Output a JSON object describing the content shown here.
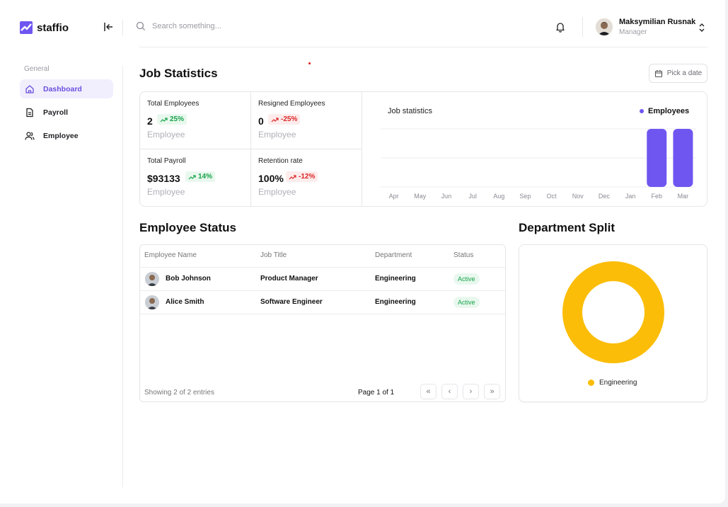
{
  "app": {
    "name": "staffio"
  },
  "search": {
    "placeholder": "Search something..."
  },
  "user": {
    "name": "Maksymilian Rusnak",
    "role": "Manager"
  },
  "sidebar": {
    "section": "General",
    "items": [
      {
        "label": "Dashboard",
        "icon": "home-icon",
        "active": true
      },
      {
        "label": "Payroll",
        "icon": "document-icon",
        "active": false
      },
      {
        "label": "Employee",
        "icon": "users-icon",
        "active": false
      }
    ]
  },
  "job_statistics": {
    "title": "Job Statistics",
    "date_button": "Pick a date",
    "stats": [
      {
        "label": "Total Employees",
        "value": "2",
        "change": "25%",
        "trend": "up",
        "unit": "Employee"
      },
      {
        "label": "Resigned Employees",
        "value": "0",
        "change": "-25%",
        "trend": "down",
        "unit": "Employee"
      },
      {
        "label": "Total Payroll",
        "value": "$93133",
        "change": "14%",
        "trend": "up",
        "unit": "Employee"
      },
      {
        "label": "Retention rate",
        "value": "100%",
        "change": "-12%",
        "trend": "down",
        "unit": "Employee"
      }
    ],
    "colors": {
      "up": "#17a34a",
      "down": "#dc2626",
      "accent": "#6f56f0"
    }
  },
  "chart_data": {
    "type": "bar",
    "title": "Job statistics",
    "categories": [
      "Apr",
      "May",
      "Jun",
      "Jul",
      "Aug",
      "Sep",
      "Oct",
      "Nov",
      "Dec",
      "Jan",
      "Feb",
      "Mar"
    ],
    "series": [
      {
        "name": "Employees",
        "values": [
          0,
          0,
          0,
          0,
          0,
          0,
          0,
          0,
          0,
          0,
          2,
          2
        ],
        "color": "#6f56f0"
      }
    ],
    "ylim": [
      0,
      2
    ],
    "grid": true,
    "legend": "top-right"
  },
  "employee_status": {
    "title": "Employee Status",
    "columns": [
      "Employee Name",
      "Job Title",
      "Department",
      "Status"
    ],
    "rows": [
      {
        "name": "Bob Johnson",
        "job_title": "Product Manager",
        "department": "Engineering",
        "status": "Active"
      },
      {
        "name": "Alice Smith",
        "job_title": "Software Engineer",
        "department": "Engineering",
        "status": "Active"
      }
    ],
    "footer": "Showing 2 of 2 entries",
    "page_info": "Page 1 of 1",
    "pagination": [
      "«",
      "‹",
      "›",
      "»"
    ]
  },
  "department_split": {
    "title": "Department Split",
    "segments": [
      {
        "label": "Engineering",
        "value": 2,
        "color": "#fbbd08"
      }
    ]
  }
}
